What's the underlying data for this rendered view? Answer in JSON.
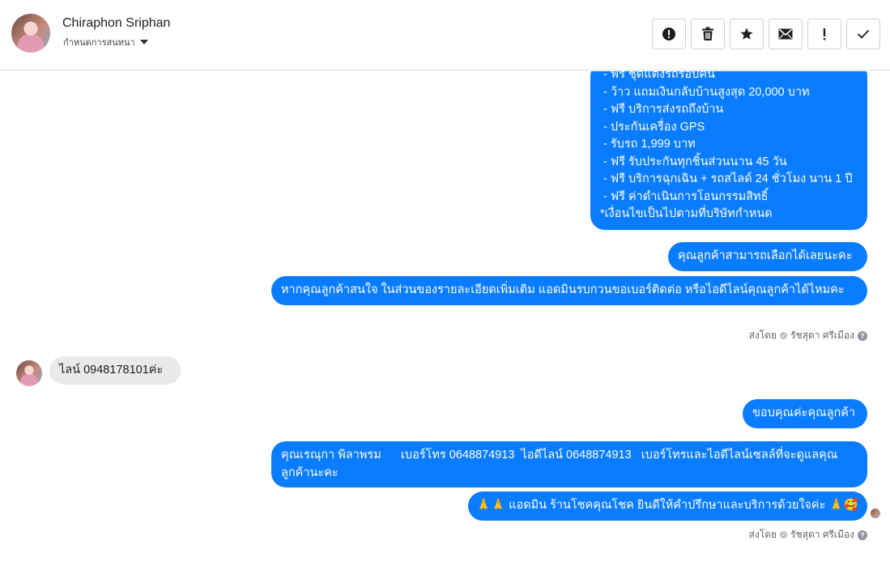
{
  "header": {
    "name": "Chiraphon Sriphan",
    "subtitle": "กำหนดการสนทนา",
    "actions": [
      {
        "id": "spam",
        "icon": "alert-circle-icon"
      },
      {
        "id": "delete",
        "icon": "trash-icon"
      },
      {
        "id": "star",
        "icon": "star-icon"
      },
      {
        "id": "unread",
        "icon": "envelope-icon"
      },
      {
        "id": "important",
        "icon": "exclamation-icon"
      },
      {
        "id": "done",
        "icon": "checkmark-icon"
      }
    ]
  },
  "messages": {
    "promo_lines": [
      " - ฟรี ชุดแต่งรถรอบคัน",
      " - ว้าว แถมเงินกลับบ้านสูงสุด 20,000 บาท",
      " - ฟรี บริการส่งรถถึงบ้าน",
      " - ประกันเครื่อง GPS",
      " - รับรถ 1,999 บาท",
      " - ฟรี รับประกันทุกชิ้นส่วนนาน 45 วัน",
      " - ฟรี บริการฉุกเฉิน + รถสไลด์ 24 ชั่วโมง นาน 1 ปี",
      " - ฟรี ค่าดำเนินการโอนกรรมสิทธิ์",
      "*เงื่อนไขเป็นไปตามที่บริษัทกำหนด"
    ],
    "choose": "คุณลูกค้าสามารถเลือกได้เลยนะคะ",
    "ask_contact": "หากคุณลูกค้าสนใจ ในส่วนของรายละเอียดเพิ่มเติม แอดมินรบกวนขอเบอร์ติดต่อ หรือไอดีไลน์คุณลูกค้าได้ไหมคะ",
    "sent_by_1": {
      "prefix": "ส่งโดย",
      "agent": "รัชสุดา ศรีเมือง"
    },
    "incoming_line": "ไลน์ 0948178101ค่ะ",
    "thanks": "ขอบคุณค่ะคุณลูกค้า",
    "sales_contact": "คุณเรณุกา พิลาพรม      เบอร์โทร 0648874913  ไอดีไลน์ 0648874913   เบอร์โทรและไอดีไลน์เซลล์ที่จะดูแลคุณลูกค้านะคะ",
    "signoff_emoji_left": "🙏🙏",
    "signoff_text": "แอดมิน ร้านโชคคุณโชค ยินดีให้คำปรึกษาและบริการด้วยใจค่ะ",
    "signoff_emoji_right": "🙏🥰",
    "sent_by_2": {
      "prefix": "ส่งโดย",
      "agent": "รัชสุดา ศรีเมือง"
    }
  },
  "colors": {
    "outgoing": "#0a7cff",
    "incoming": "#e9eaec"
  }
}
